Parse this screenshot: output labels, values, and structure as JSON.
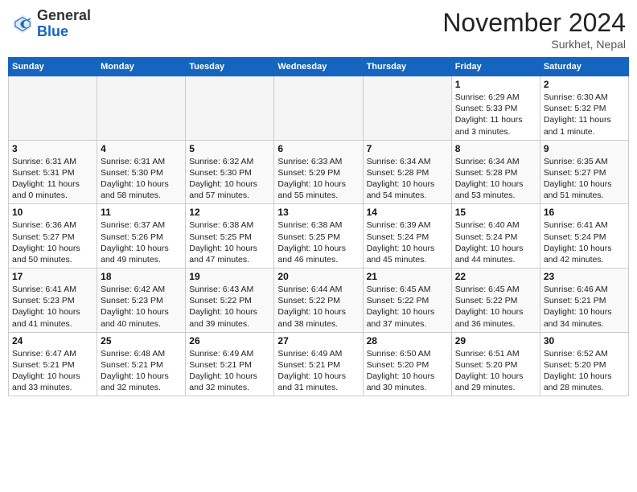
{
  "header": {
    "logo_general": "General",
    "logo_blue": "Blue",
    "month": "November 2024",
    "location": "Surkhet, Nepal"
  },
  "weekdays": [
    "Sunday",
    "Monday",
    "Tuesday",
    "Wednesday",
    "Thursday",
    "Friday",
    "Saturday"
  ],
  "weeks": [
    [
      {
        "day": "",
        "info": ""
      },
      {
        "day": "",
        "info": ""
      },
      {
        "day": "",
        "info": ""
      },
      {
        "day": "",
        "info": ""
      },
      {
        "day": "",
        "info": ""
      },
      {
        "day": "1",
        "info": "Sunrise: 6:29 AM\nSunset: 5:33 PM\nDaylight: 11 hours\nand 3 minutes."
      },
      {
        "day": "2",
        "info": "Sunrise: 6:30 AM\nSunset: 5:32 PM\nDaylight: 11 hours\nand 1 minute."
      }
    ],
    [
      {
        "day": "3",
        "info": "Sunrise: 6:31 AM\nSunset: 5:31 PM\nDaylight: 11 hours\nand 0 minutes."
      },
      {
        "day": "4",
        "info": "Sunrise: 6:31 AM\nSunset: 5:30 PM\nDaylight: 10 hours\nand 58 minutes."
      },
      {
        "day": "5",
        "info": "Sunrise: 6:32 AM\nSunset: 5:30 PM\nDaylight: 10 hours\nand 57 minutes."
      },
      {
        "day": "6",
        "info": "Sunrise: 6:33 AM\nSunset: 5:29 PM\nDaylight: 10 hours\nand 55 minutes."
      },
      {
        "day": "7",
        "info": "Sunrise: 6:34 AM\nSunset: 5:28 PM\nDaylight: 10 hours\nand 54 minutes."
      },
      {
        "day": "8",
        "info": "Sunrise: 6:34 AM\nSunset: 5:28 PM\nDaylight: 10 hours\nand 53 minutes."
      },
      {
        "day": "9",
        "info": "Sunrise: 6:35 AM\nSunset: 5:27 PM\nDaylight: 10 hours\nand 51 minutes."
      }
    ],
    [
      {
        "day": "10",
        "info": "Sunrise: 6:36 AM\nSunset: 5:27 PM\nDaylight: 10 hours\nand 50 minutes."
      },
      {
        "day": "11",
        "info": "Sunrise: 6:37 AM\nSunset: 5:26 PM\nDaylight: 10 hours\nand 49 minutes."
      },
      {
        "day": "12",
        "info": "Sunrise: 6:38 AM\nSunset: 5:25 PM\nDaylight: 10 hours\nand 47 minutes."
      },
      {
        "day": "13",
        "info": "Sunrise: 6:38 AM\nSunset: 5:25 PM\nDaylight: 10 hours\nand 46 minutes."
      },
      {
        "day": "14",
        "info": "Sunrise: 6:39 AM\nSunset: 5:24 PM\nDaylight: 10 hours\nand 45 minutes."
      },
      {
        "day": "15",
        "info": "Sunrise: 6:40 AM\nSunset: 5:24 PM\nDaylight: 10 hours\nand 44 minutes."
      },
      {
        "day": "16",
        "info": "Sunrise: 6:41 AM\nSunset: 5:24 PM\nDaylight: 10 hours\nand 42 minutes."
      }
    ],
    [
      {
        "day": "17",
        "info": "Sunrise: 6:41 AM\nSunset: 5:23 PM\nDaylight: 10 hours\nand 41 minutes."
      },
      {
        "day": "18",
        "info": "Sunrise: 6:42 AM\nSunset: 5:23 PM\nDaylight: 10 hours\nand 40 minutes."
      },
      {
        "day": "19",
        "info": "Sunrise: 6:43 AM\nSunset: 5:22 PM\nDaylight: 10 hours\nand 39 minutes."
      },
      {
        "day": "20",
        "info": "Sunrise: 6:44 AM\nSunset: 5:22 PM\nDaylight: 10 hours\nand 38 minutes."
      },
      {
        "day": "21",
        "info": "Sunrise: 6:45 AM\nSunset: 5:22 PM\nDaylight: 10 hours\nand 37 minutes."
      },
      {
        "day": "22",
        "info": "Sunrise: 6:45 AM\nSunset: 5:22 PM\nDaylight: 10 hours\nand 36 minutes."
      },
      {
        "day": "23",
        "info": "Sunrise: 6:46 AM\nSunset: 5:21 PM\nDaylight: 10 hours\nand 34 minutes."
      }
    ],
    [
      {
        "day": "24",
        "info": "Sunrise: 6:47 AM\nSunset: 5:21 PM\nDaylight: 10 hours\nand 33 minutes."
      },
      {
        "day": "25",
        "info": "Sunrise: 6:48 AM\nSunset: 5:21 PM\nDaylight: 10 hours\nand 32 minutes."
      },
      {
        "day": "26",
        "info": "Sunrise: 6:49 AM\nSunset: 5:21 PM\nDaylight: 10 hours\nand 32 minutes."
      },
      {
        "day": "27",
        "info": "Sunrise: 6:49 AM\nSunset: 5:21 PM\nDaylight: 10 hours\nand 31 minutes."
      },
      {
        "day": "28",
        "info": "Sunrise: 6:50 AM\nSunset: 5:20 PM\nDaylight: 10 hours\nand 30 minutes."
      },
      {
        "day": "29",
        "info": "Sunrise: 6:51 AM\nSunset: 5:20 PM\nDaylight: 10 hours\nand 29 minutes."
      },
      {
        "day": "30",
        "info": "Sunrise: 6:52 AM\nSunset: 5:20 PM\nDaylight: 10 hours\nand 28 minutes."
      }
    ]
  ]
}
